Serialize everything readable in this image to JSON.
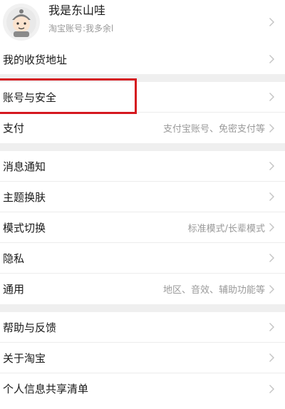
{
  "profile": {
    "name": "我是东山哇",
    "account": "淘宝账号:我多余l"
  },
  "settings": [
    {
      "label": "我的收货地址",
      "value": ""
    },
    {
      "label": "账号与安全",
      "value": ""
    },
    {
      "label": "支付",
      "value": "支付宝账号、免密支付等"
    },
    {
      "label": "消息通知",
      "value": ""
    },
    {
      "label": "主题换肤",
      "value": ""
    },
    {
      "label": "模式切换",
      "value": "标准模式/长辈模式"
    },
    {
      "label": "隐私",
      "value": ""
    },
    {
      "label": "通用",
      "value": "地区、音效、辅助功能等"
    },
    {
      "label": "帮助与反馈",
      "value": ""
    },
    {
      "label": "关于淘宝",
      "value": ""
    },
    {
      "label": "个人信息共享清单",
      "value": ""
    }
  ],
  "icons": {
    "avatar": "avatar-cartoon-icon",
    "chevron": "chevron-right-icon"
  },
  "colors": {
    "highlight": "#d5181f",
    "divider": "#efefef",
    "secondary_text": "#9a9a9a"
  }
}
